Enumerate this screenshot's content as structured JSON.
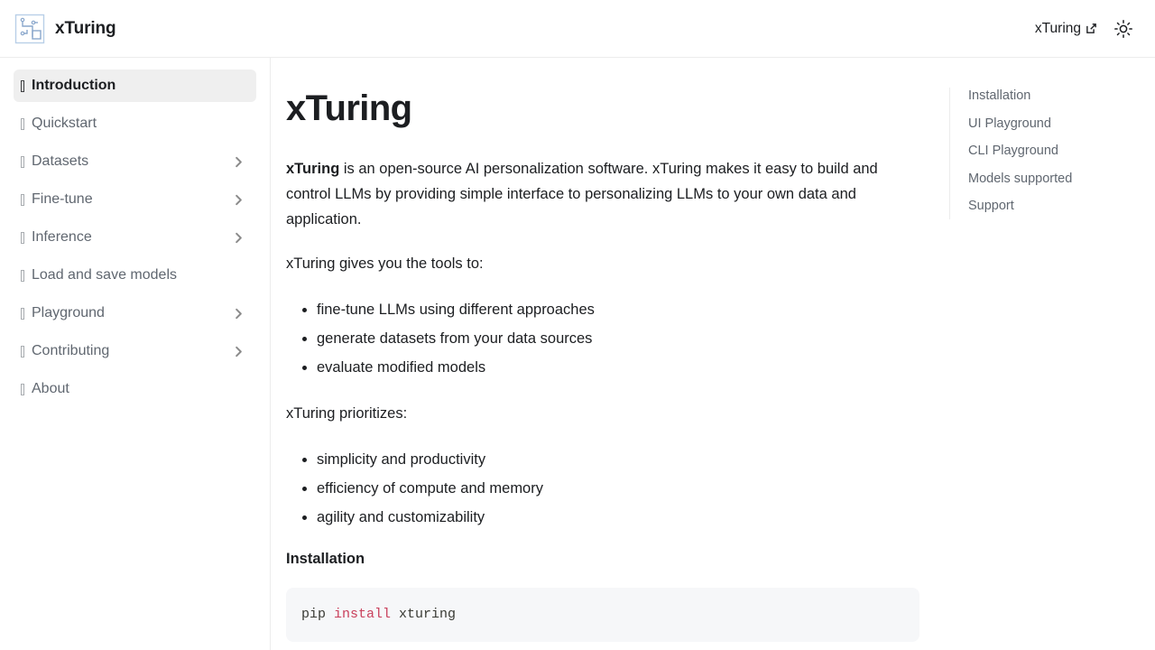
{
  "navbar": {
    "brand_label": "xTuring",
    "logo_icon": "xturing-circuit-logo",
    "right_link_label": "xTuring",
    "external_link_icon": "external-link-icon",
    "theme_toggle_icon": "sun-icon"
  },
  "sidebar": {
    "items": [
      {
        "emoji_placeholder": "▯",
        "label": "Introduction",
        "active": true,
        "expandable": false
      },
      {
        "emoji_placeholder": "▯",
        "label": "Quickstart",
        "active": false,
        "expandable": false
      },
      {
        "emoji_placeholder": "▯",
        "label": "Datasets",
        "active": false,
        "expandable": true
      },
      {
        "emoji_placeholder": "▯",
        "label": "Fine-tune",
        "active": false,
        "expandable": true
      },
      {
        "emoji_placeholder": "▯",
        "label": "Inference",
        "active": false,
        "expandable": true
      },
      {
        "emoji_placeholder": "▯",
        "label": "Load and save models",
        "active": false,
        "expandable": false
      },
      {
        "emoji_placeholder": "▯",
        "label": "Playground",
        "active": false,
        "expandable": true
      },
      {
        "emoji_placeholder": "▯",
        "label": "Contributing",
        "active": false,
        "expandable": true
      },
      {
        "emoji_placeholder": "▯",
        "label": "About",
        "active": false,
        "expandable": false
      }
    ]
  },
  "article": {
    "title": "xTuring",
    "intro_bold": "xTuring",
    "intro_rest": " is an open-source AI personalization software. xTuring makes it easy to build and control LLMs by providing simple interface to personalizing LLMs to your own data and application.",
    "tools_lead": "xTuring gives you the tools to:",
    "tools_list": [
      "fine-tune LLMs using different approaches",
      "generate datasets from your data sources",
      "evaluate modified models"
    ],
    "priorities_lead": "xTuring prioritizes:",
    "priorities_list": [
      "simplicity and productivity",
      "efficiency of compute and memory",
      "agility and customizability"
    ],
    "installation_heading": "Installation",
    "code": {
      "prefix": "pip ",
      "keyword": "install",
      "suffix": " xturing"
    }
  },
  "toc": {
    "items": [
      "Installation",
      "UI Playground",
      "CLI Playground",
      "Models supported",
      "Support"
    ]
  },
  "colors": {
    "accent_keyword": "#c9405c",
    "code_bg": "#f6f7f9",
    "active_item_bg": "#efefef",
    "border": "#ececec",
    "text_primary": "#1c1e21",
    "text_muted": "#606770"
  }
}
